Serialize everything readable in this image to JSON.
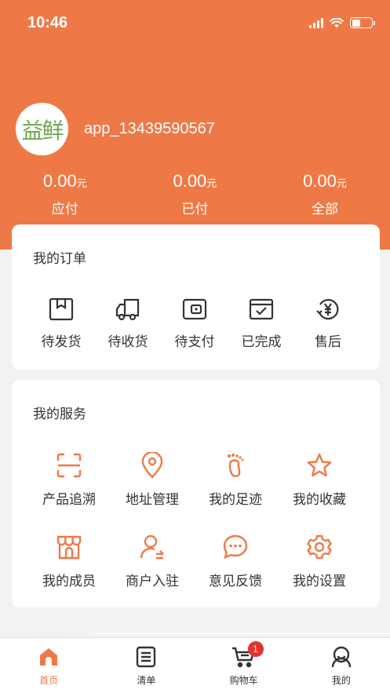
{
  "status_bar": {
    "time": "10:46"
  },
  "profile": {
    "avatar_text": "益鲜",
    "username": "app_13439590567"
  },
  "balances": [
    {
      "amount": "0.00",
      "unit": "元",
      "label": "应付"
    },
    {
      "amount": "0.00",
      "unit": "元",
      "label": "已付"
    },
    {
      "amount": "0.00",
      "unit": "元",
      "label": "全部"
    }
  ],
  "orders": {
    "title": "我的订单",
    "items": [
      {
        "label": "待发货",
        "icon": "package-icon"
      },
      {
        "label": "待收货",
        "icon": "truck-icon"
      },
      {
        "label": "待支付",
        "icon": "wallet-icon"
      },
      {
        "label": "已完成",
        "icon": "completed-box-icon"
      },
      {
        "label": "售后",
        "icon": "yen-refund-icon"
      }
    ]
  },
  "services": {
    "title": "我的服务",
    "items": [
      {
        "label": "产品追溯",
        "icon": "scan-icon"
      },
      {
        "label": "地址管理",
        "icon": "location-pin-icon"
      },
      {
        "label": "我的足迹",
        "icon": "footprint-icon"
      },
      {
        "label": "我的收藏",
        "icon": "star-icon"
      },
      {
        "label": "我的成员",
        "icon": "store-icon"
      },
      {
        "label": "商户入驻",
        "icon": "merchant-user-icon"
      },
      {
        "label": "意见反馈",
        "icon": "chat-bubble-icon"
      },
      {
        "label": "我的设置",
        "icon": "gear-icon"
      }
    ]
  },
  "bottom_nav": {
    "items": [
      {
        "label": "首页",
        "icon": "home-icon",
        "active": true
      },
      {
        "label": "清单",
        "icon": "list-icon",
        "active": false
      },
      {
        "label": "购物车",
        "icon": "cart-icon",
        "active": false,
        "badge": "1"
      },
      {
        "label": "我的",
        "icon": "user-icon",
        "active": false
      }
    ]
  },
  "colors": {
    "accent": "#ee7946",
    "badge": "#e5322d",
    "icon_dark": "#333333"
  }
}
